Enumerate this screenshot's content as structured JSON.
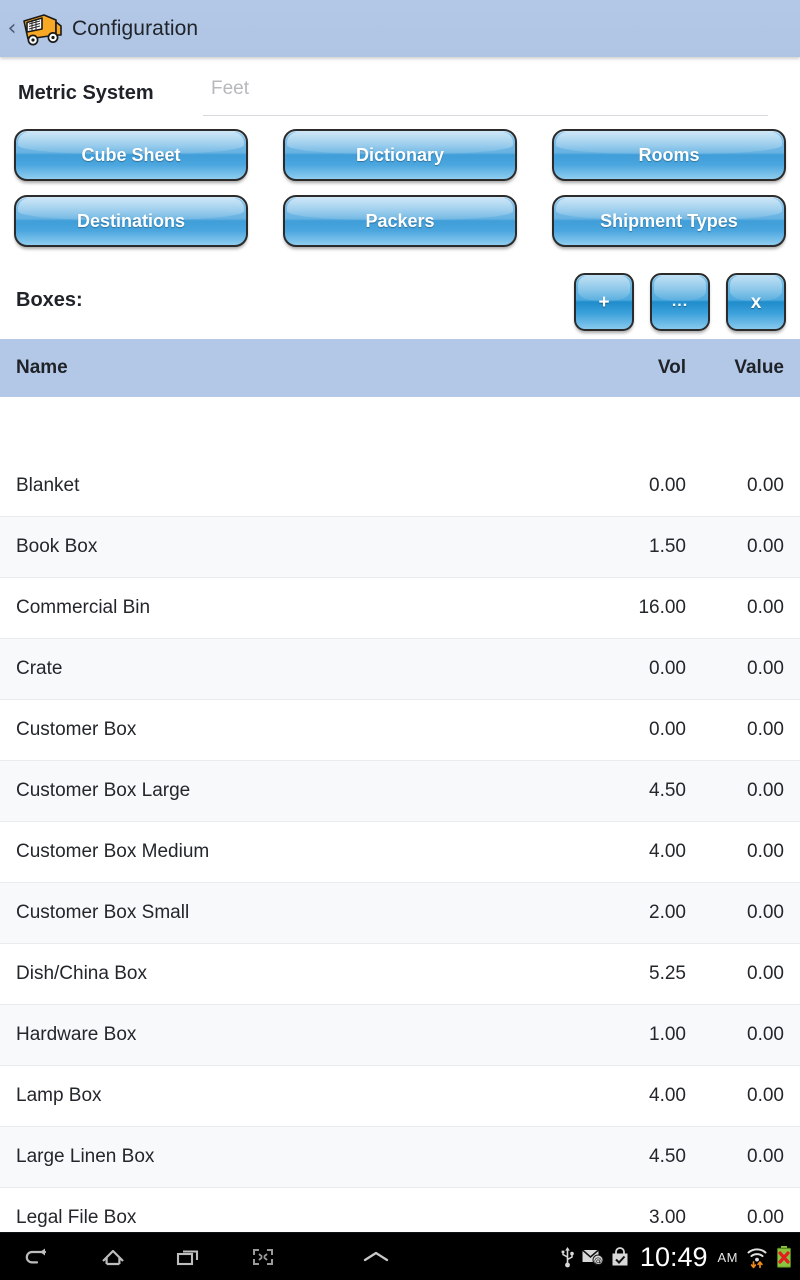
{
  "titlebar": {
    "back_label": "‹",
    "icon": "moving-truck-icon",
    "title": "Configuration"
  },
  "metric": {
    "label": "Metric System",
    "value": "Feet",
    "placeholder": "Feet"
  },
  "nav_buttons": [
    {
      "label": "Cube Sheet"
    },
    {
      "label": "Dictionary"
    },
    {
      "label": "Rooms"
    },
    {
      "label": "Destinations"
    },
    {
      "label": "Packers"
    },
    {
      "label": "Shipment Types"
    }
  ],
  "boxes": {
    "label": "Boxes:",
    "actions": [
      {
        "label": "+",
        "name": "add-box-button"
      },
      {
        "label": "...",
        "name": "more-box-button"
      },
      {
        "label": "x",
        "name": "delete-box-button"
      }
    ]
  },
  "table": {
    "columns": [
      "Name",
      "Vol",
      "Value"
    ],
    "rows": [
      {
        "name": "Blanket",
        "vol": "0.00",
        "value": "0.00"
      },
      {
        "name": "Book Box",
        "vol": "1.50",
        "value": "0.00"
      },
      {
        "name": "Commercial Bin",
        "vol": "16.00",
        "value": "0.00"
      },
      {
        "name": "Crate",
        "vol": "0.00",
        "value": "0.00"
      },
      {
        "name": "Customer Box",
        "vol": "0.00",
        "value": "0.00"
      },
      {
        "name": "Customer Box Large",
        "vol": "4.50",
        "value": "0.00"
      },
      {
        "name": "Customer Box Medium",
        "vol": "4.00",
        "value": "0.00"
      },
      {
        "name": "Customer Box Small",
        "vol": "2.00",
        "value": "0.00"
      },
      {
        "name": "Dish/China Box",
        "vol": "5.25",
        "value": "0.00"
      },
      {
        "name": "Hardware Box",
        "vol": "1.00",
        "value": "0.00"
      },
      {
        "name": "Lamp Box",
        "vol": "4.00",
        "value": "0.00"
      },
      {
        "name": "Large Linen Box",
        "vol": "4.50",
        "value": "0.00"
      },
      {
        "name": "Legal File Box",
        "vol": "3.00",
        "value": "0.00"
      }
    ]
  },
  "navbar": {
    "buttons": [
      {
        "name": "back-icon"
      },
      {
        "name": "home-icon"
      },
      {
        "name": "recent-apps-icon"
      },
      {
        "name": "screenshot-icon"
      },
      {
        "name": "chevron-up-icon"
      }
    ]
  },
  "statusbar": {
    "time": "10:49",
    "ampm": "AM",
    "icons": [
      "usb-icon",
      "email-icon",
      "check-bag-icon",
      "wifi-icon",
      "battery-error-icon"
    ]
  },
  "colors": {
    "titlebar_blue": "#b3c8e6",
    "table_header_blue": "#b3c8e6",
    "button_blue": "#3f9dd8",
    "row_alt": "#f7f9fb",
    "truck_orange": "#f5a623"
  }
}
